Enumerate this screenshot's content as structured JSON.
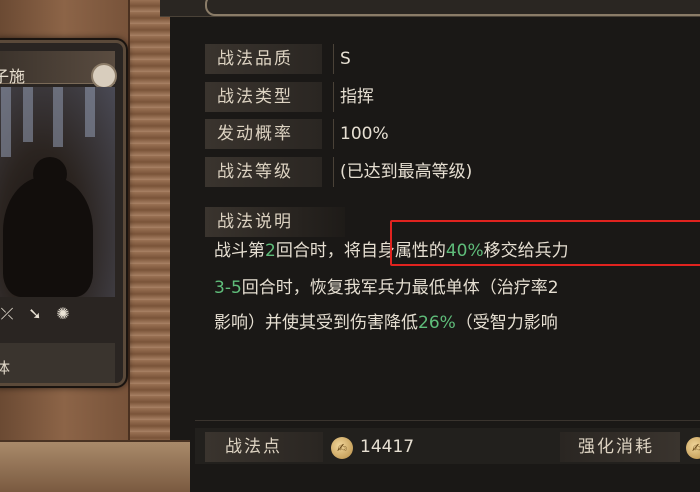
{
  "card": {
    "name": "子施",
    "footer": "体",
    "icons": [
      "bow-icon",
      "arrow-icon",
      "wheel-icon"
    ]
  },
  "attributes": [
    {
      "label": "战法品质",
      "value": "S"
    },
    {
      "label": "战法类型",
      "value": "指挥"
    },
    {
      "label": "发动概率",
      "value": "100%"
    },
    {
      "label": "战法等级",
      "value": "(已达到最高等级)"
    }
  ],
  "description": {
    "label": "战法说明",
    "line1": {
      "pre": "战斗第",
      "num": "2",
      "mid": "回合时，",
      "boxed_pre": "将自身属性的",
      "boxed_pct": "40%",
      "boxed_post": "移交给兵力"
    },
    "line2": {
      "range": "3-5",
      "text": "回合时，恢复我军兵力最低单体（治疗率2"
    },
    "line3": {
      "pre": "影响）并使其受到伤害降低",
      "pct": "26%",
      "post": "（受智力影响"
    }
  },
  "bottom": {
    "points_label": "战法点",
    "points_value": "14417",
    "cost_label": "强化消耗"
  },
  "colors": {
    "highlight": "#5fbd7a",
    "annotation_box": "#e0231f"
  }
}
